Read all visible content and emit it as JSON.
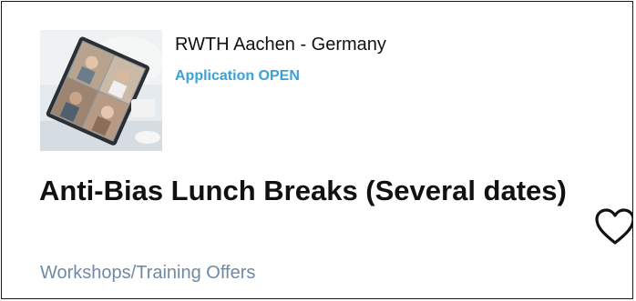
{
  "card": {
    "location": "RWTH Aachen - Germany",
    "status": "Application OPEN",
    "title": "Anti-Bias Lunch Breaks (Several dates)",
    "category": "Workshops/Training Offers",
    "favorite_icon": "heart-outline-icon",
    "colors": {
      "status": "#3da0d6",
      "category": "#6e8aa4",
      "text": "#111111",
      "border": "#1a1a1a"
    }
  }
}
